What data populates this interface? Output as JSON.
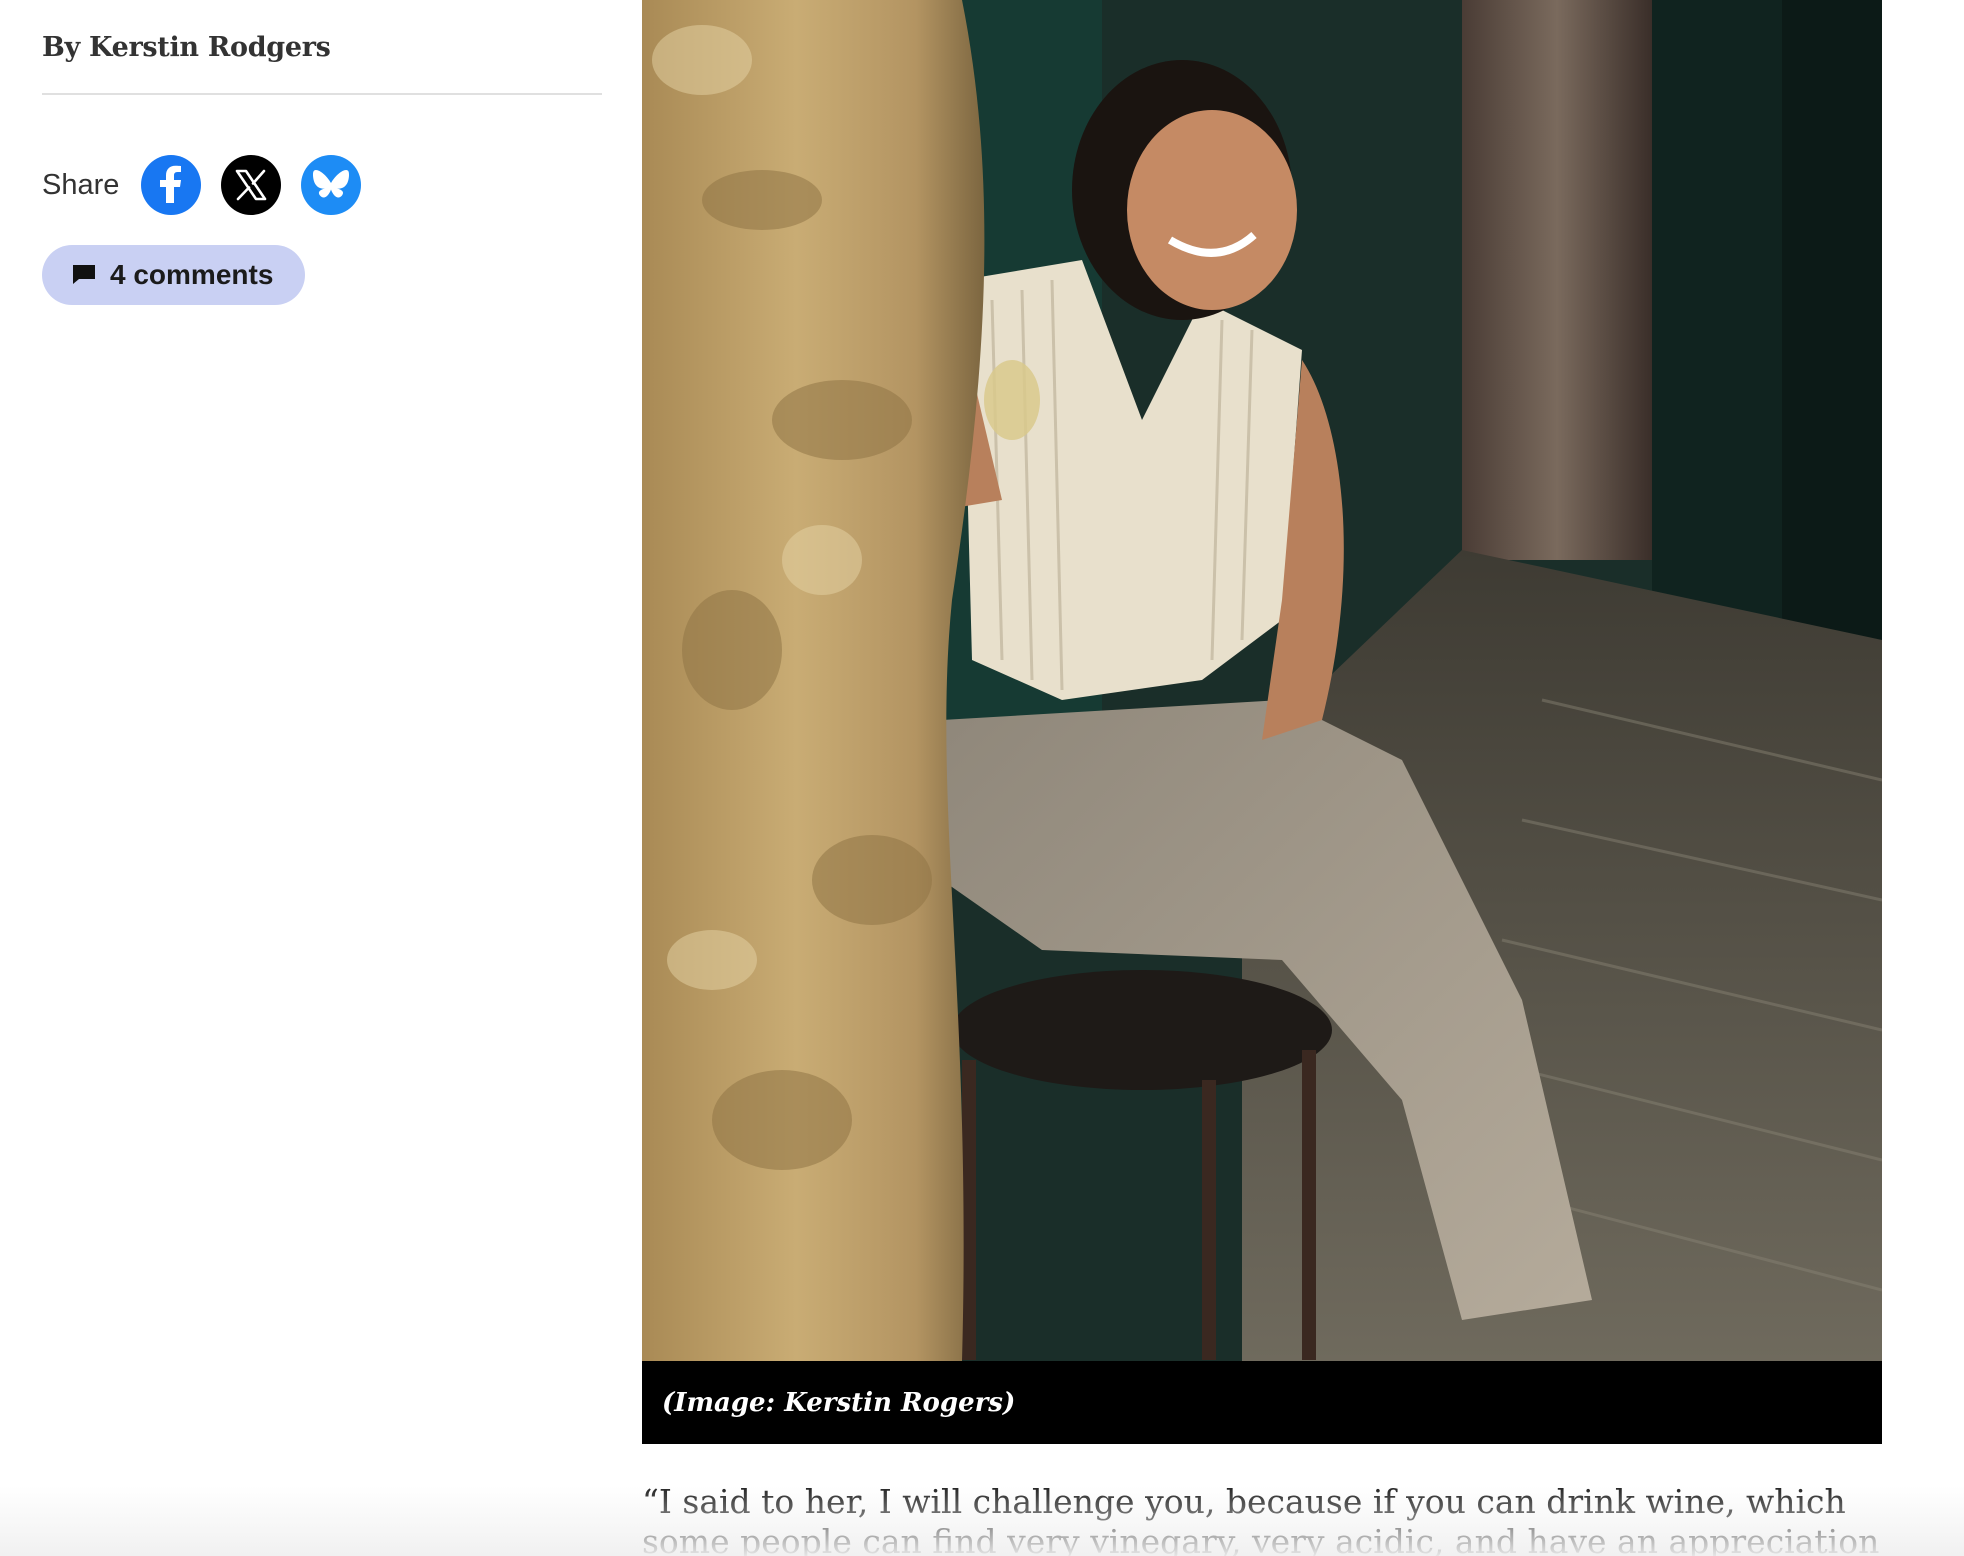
{
  "article": {
    "byline": "By Kerstin Rodgers",
    "share_label": "Share",
    "share_buttons": [
      {
        "name": "facebook",
        "icon": "facebook-icon",
        "color": "#1877f2"
      },
      {
        "name": "x",
        "icon": "x-icon",
        "color": "#000000"
      },
      {
        "name": "bluesky",
        "icon": "bluesky-icon",
        "color": "#1d8cf5"
      }
    ],
    "comments_label": "4 comments",
    "comments_icon": "comment-bubble-icon",
    "comments_pill_color": "#c9d0f3"
  },
  "figure": {
    "caption": "(Image: Kerstin Rogers)"
  },
  "body": {
    "paragraph": "“I said to her, I will challenge you, because if you can drink wine, which some people can find very vinegary, very acidic, and have an appreciation for the"
  }
}
